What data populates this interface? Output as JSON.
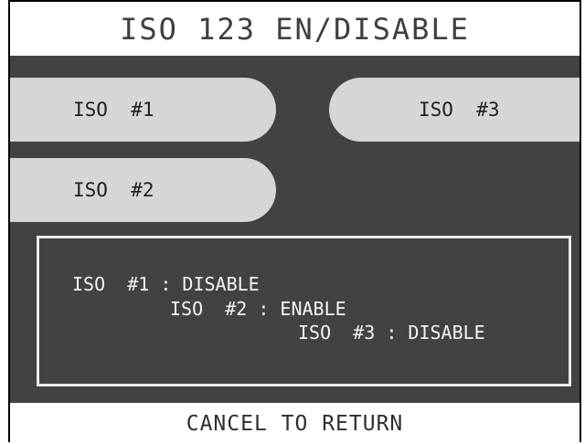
{
  "header": {
    "title": "ISO 123 EN/DISABLE"
  },
  "options": [
    {
      "label": "ISO  #1"
    },
    {
      "label": "ISO  #2"
    },
    {
      "label": "ISO  #3"
    }
  ],
  "status": {
    "lines": [
      "ISO  #1 : DISABLE",
      "ISO  #2 : ENABLE",
      "ISO  #3 : DISABLE"
    ]
  },
  "footer": {
    "text": "CANCEL TO RETURN"
  }
}
